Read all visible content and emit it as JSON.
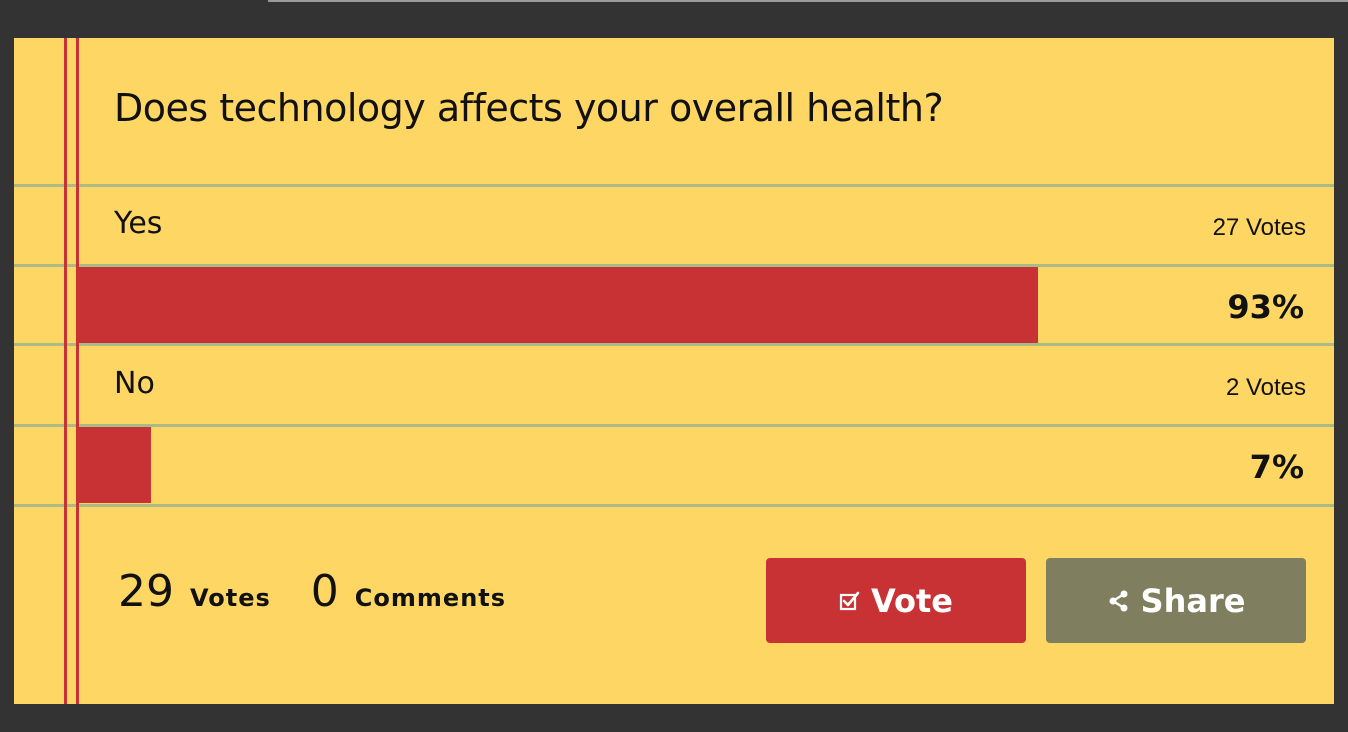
{
  "poll": {
    "question": "Does technology affects your overall health?",
    "options": [
      {
        "label": "Yes",
        "votes": "27 Votes",
        "percent_text": "93%",
        "percent": 93
      },
      {
        "label": "No",
        "votes": "2 Votes",
        "percent_text": "7%",
        "percent": 7
      }
    ]
  },
  "footer": {
    "vote_count": "29",
    "vote_label": "Votes",
    "comment_count": "0",
    "comment_label": "Comments"
  },
  "buttons": {
    "vote_label": "Vote",
    "vote_icon": "check-square-icon",
    "share_label": "Share",
    "share_icon": "share-icon"
  },
  "colors": {
    "card_background": "#fed663",
    "accent_red": "#c83234",
    "share_button": "#7f7f5f",
    "ruled_line": "#a9bc86"
  }
}
